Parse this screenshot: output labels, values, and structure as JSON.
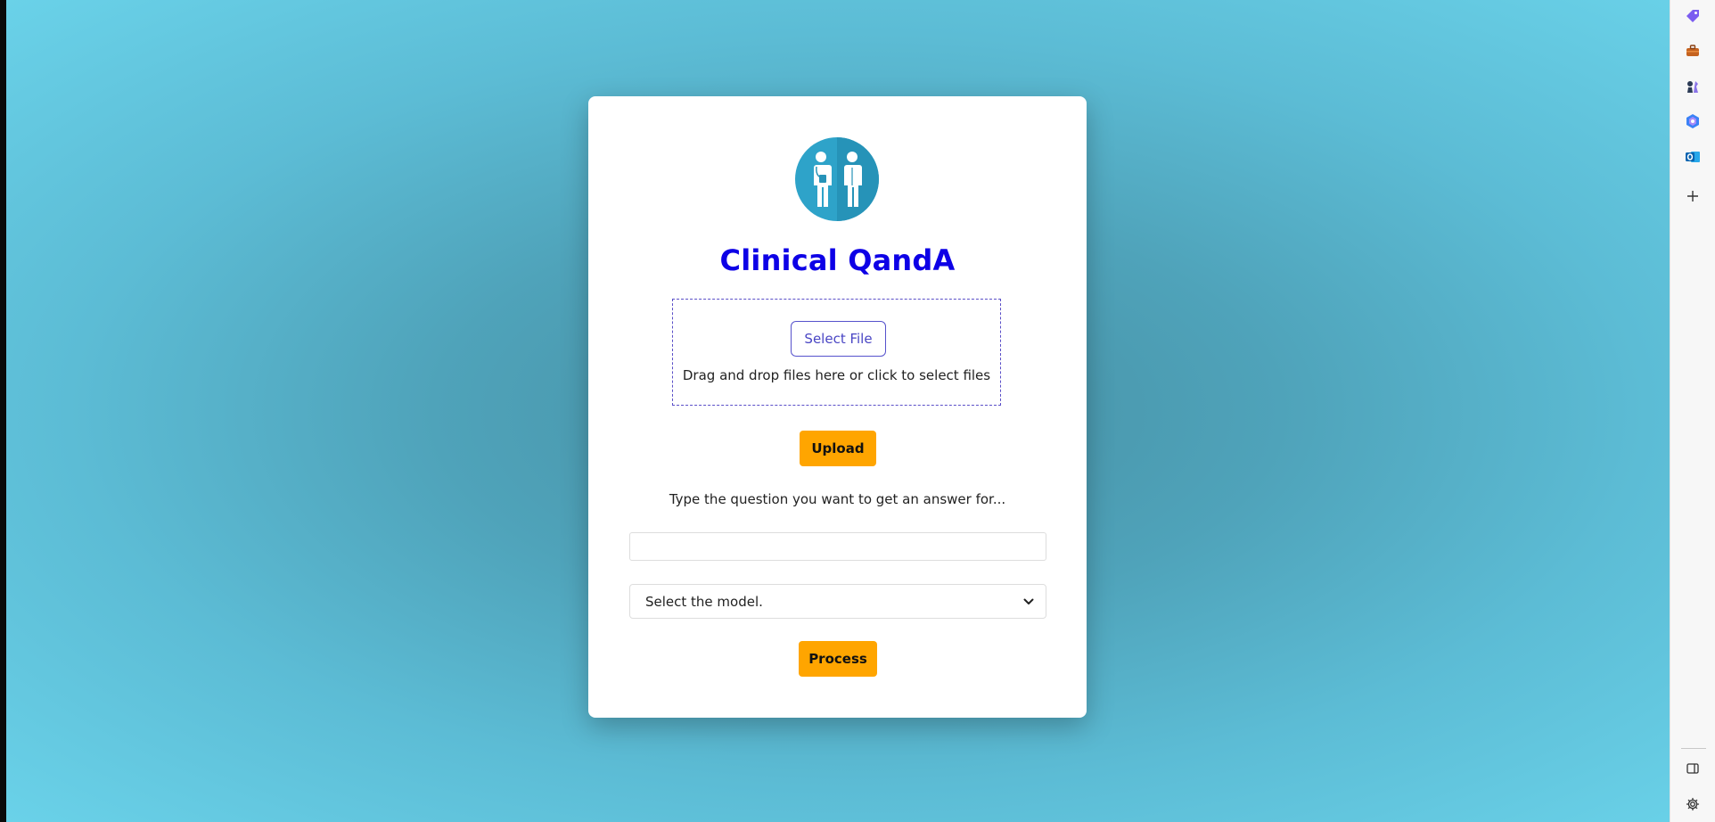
{
  "app": {
    "title": "Clinical QandA"
  },
  "upload": {
    "select_file_label": "Select File",
    "drop_text": "Drag and drop files here or click to select files",
    "upload_label": "Upload"
  },
  "question": {
    "prompt": "Type the question you want to get an answer for...",
    "value": "",
    "placeholder": ""
  },
  "model": {
    "selected": "Select the model."
  },
  "actions": {
    "process_label": "Process"
  },
  "sidebar": {
    "icons": [
      "tag-icon",
      "briefcase-icon",
      "chess-icon",
      "copilot-icon",
      "outlook-icon",
      "add-icon"
    ],
    "bottom_icons": [
      "sidebar-toggle-icon",
      "settings-icon"
    ]
  },
  "colors": {
    "title": "#0d00e6",
    "accent_button": "#ffa500",
    "select_file_border": "#5652cc",
    "logo_circle": "#2ea3c9"
  }
}
